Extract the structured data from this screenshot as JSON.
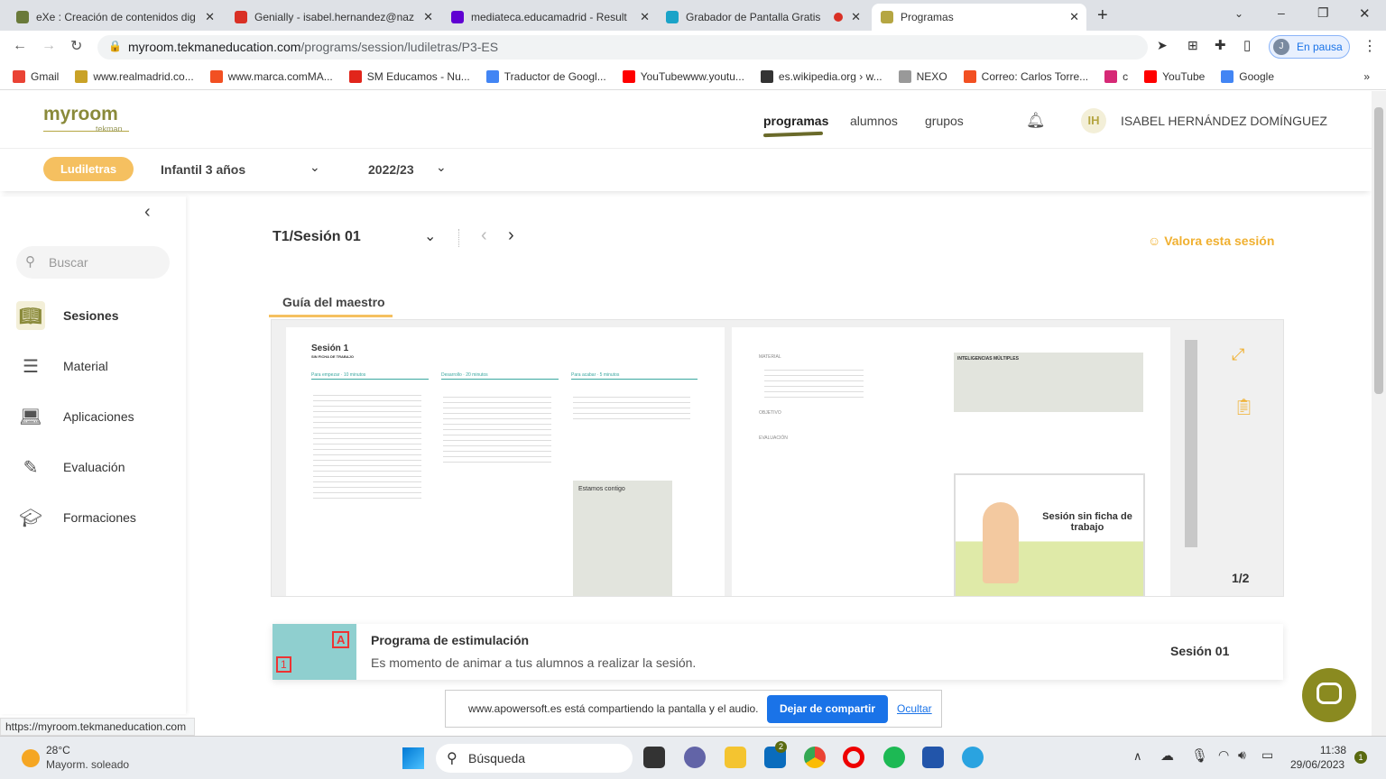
{
  "browser": {
    "tabs": [
      {
        "label": "eXe : Creación de contenidos dig",
        "color": "#6a7a3a"
      },
      {
        "label": "Genially - isabel.hernandez@naz",
        "color": "#d93025"
      },
      {
        "label": "mediateca.educamadrid - Result",
        "color": "#6001d2"
      },
      {
        "label": "Grabador de Pantalla Gratis",
        "color": "#1aa3c8"
      },
      {
        "label": "Programas",
        "color": "#b5a642"
      }
    ],
    "url_host": "myroom.tekmaneducation.com",
    "url_path": "/programs/session/ludiletras/P3-ES",
    "profile_label": "En pausa",
    "profile_initial": "J",
    "bookmarks": [
      {
        "label": "Gmail",
        "color": "#ea4335"
      },
      {
        "label": "www.realmadrid.co...",
        "color": "#c9a227"
      },
      {
        "label": "www.marca.comMA...",
        "color": "#f25022"
      },
      {
        "label": "SM Educamos - Nu...",
        "color": "#e1251b"
      },
      {
        "label": "Traductor de Googl...",
        "color": "#4285f4"
      },
      {
        "label": "YouTubewww.youtu...",
        "color": "#ff0000"
      },
      {
        "label": "es.wikipedia.org › w...",
        "color": "#333333"
      },
      {
        "label": "NEXO",
        "color": "#999999"
      },
      {
        "label": "Correo: Carlos Torre...",
        "color": "#f25022"
      },
      {
        "label": "c",
        "color": "#d62976"
      },
      {
        "label": "YouTube",
        "color": "#ff0000"
      },
      {
        "label": "Google",
        "color": "#4285f4"
      }
    ],
    "status_url": "https://myroom.tekmaneducation.com"
  },
  "app": {
    "logo": "myroom",
    "logo_sub": "tekman",
    "nav": [
      "programas",
      "alumnos",
      "grupos"
    ],
    "user_initials": "IH",
    "user_name": "ISABEL HERNÁNDEZ DOMÍNGUEZ",
    "program": "Ludiletras",
    "level": "Infantil 3 años",
    "year": "2022/23",
    "accent": "#f5c060"
  },
  "sidebar": {
    "search_placeholder": "Buscar",
    "items": [
      "Sesiones",
      "Material",
      "Aplicaciones",
      "Evaluación",
      "Formaciones"
    ]
  },
  "main": {
    "session": "T1/Sesión 01",
    "rate": "Valora esta sesión",
    "tab": "Guía del maestro",
    "page_counter": "1/2",
    "doc": {
      "title": "Sesión 1",
      "subtitle": "SIN FICHA DE TRABAJO",
      "col1": "Para empezar · 10 minutos",
      "col2": "Desarrollo · 20 minutos",
      "col3": "Para acabar · 5 minutos",
      "box": "Estamos contigo",
      "right_box": "INTELIGENCIAS MÚLTIPLES",
      "card": "Sesión sin ficha de trabajo",
      "materials": "MATERIAL",
      "objective": "OBJETIVO",
      "evaluation": "EVALUACIÓN"
    }
  },
  "promo": {
    "title": "Programa de estimulación",
    "text": "Es momento de animar a tus alumnos a realizar la sesión.",
    "session": "Sesión 01"
  },
  "share": {
    "text": "www.apowersoft.es está compartiendo la pantalla y el audio.",
    "stop": "Dejar de compartir",
    "hide": "Ocultar"
  },
  "taskbar": {
    "temp": "28°C",
    "weather": "Mayorm. soleado",
    "search": "Búsqueda",
    "time": "11:38",
    "date": "29/06/2023",
    "mail_badge": "2",
    "notif": "1"
  }
}
